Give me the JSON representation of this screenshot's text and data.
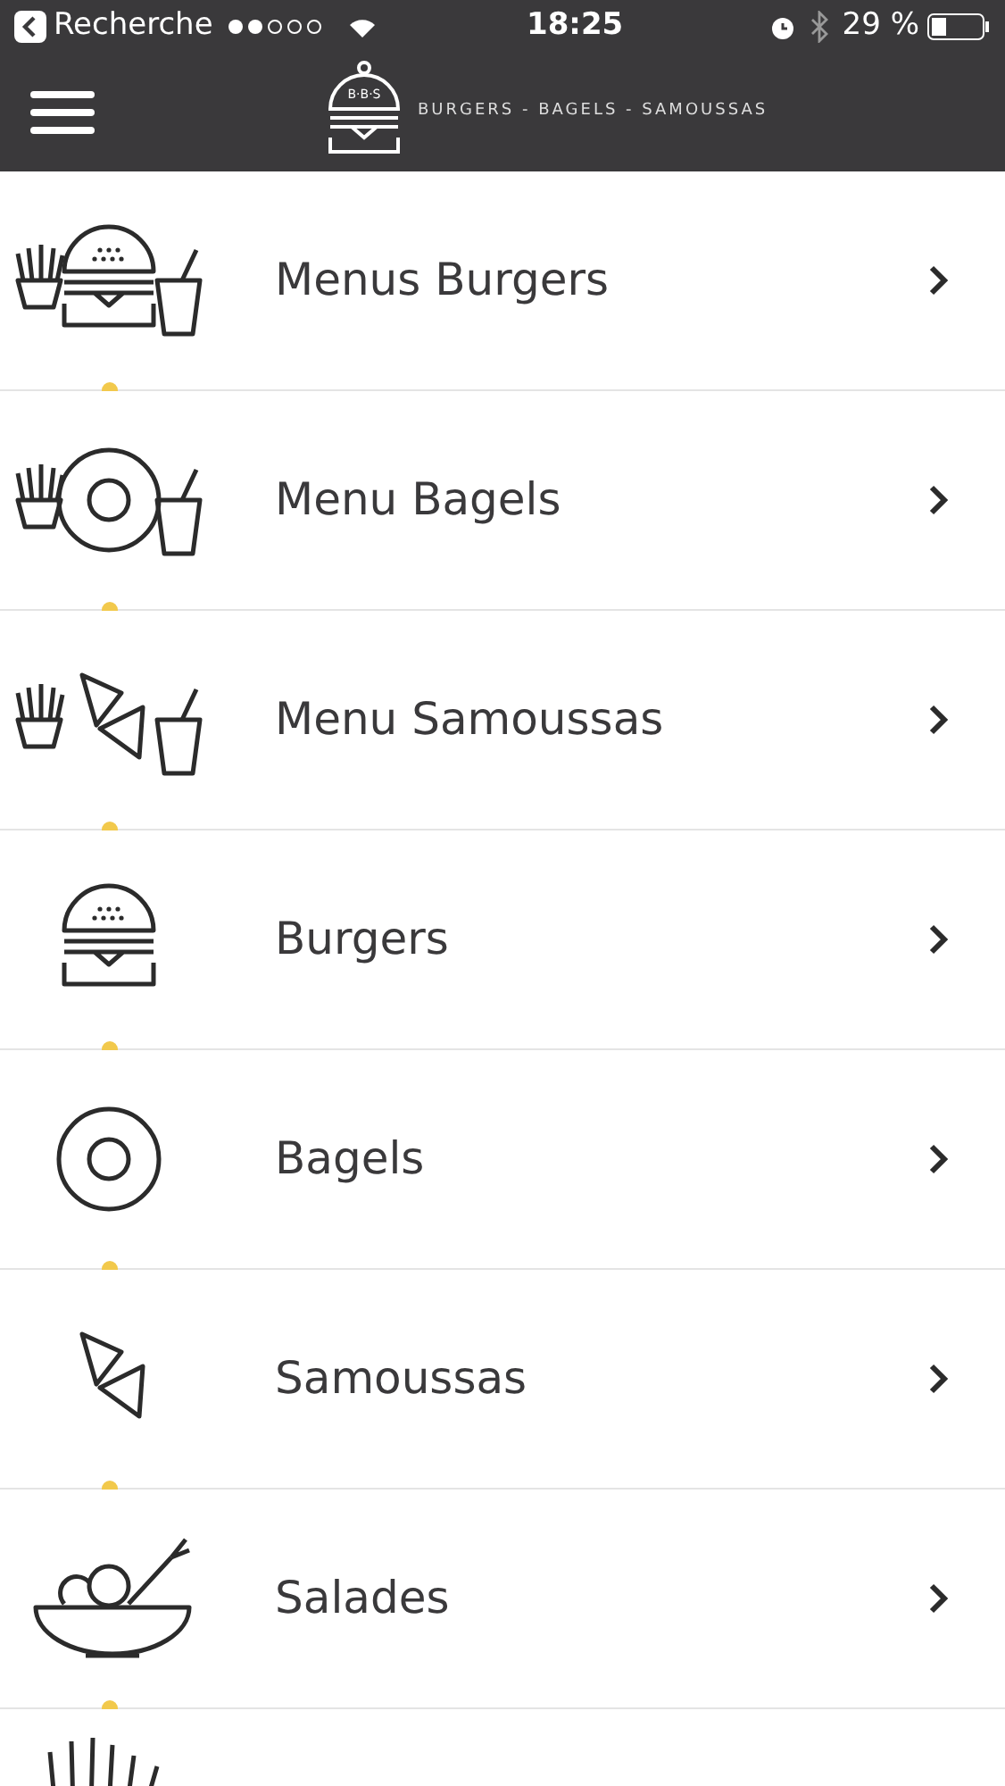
{
  "status_bar": {
    "back_label": "Recherche",
    "time": "18:25",
    "battery": "29 %"
  },
  "header": {
    "logo_text": "B·B·S",
    "tagline": "BURGERS - BAGELS - SAMOUSSAS"
  },
  "menu_items": [
    {
      "kind": "combo-burger",
      "label": "Menus Burgers"
    },
    {
      "kind": "combo-bagel",
      "label": "Menu Bagels"
    },
    {
      "kind": "combo-samosa",
      "label": "Menu Samoussas"
    },
    {
      "kind": "burger",
      "label": "Burgers"
    },
    {
      "kind": "bagel",
      "label": "Bagels"
    },
    {
      "kind": "samosa",
      "label": "Samoussas"
    },
    {
      "kind": "salad",
      "label": "Salades"
    },
    {
      "kind": "fries"
    }
  ]
}
